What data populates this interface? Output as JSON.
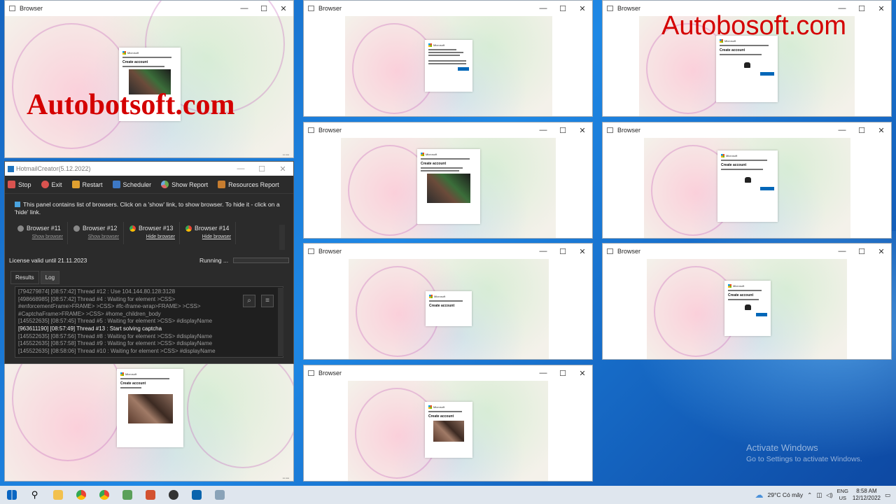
{
  "browser_windows": [
    {
      "title": "Browser"
    },
    {
      "title": "Browser"
    },
    {
      "title": "Browser"
    },
    {
      "title": "Browser"
    },
    {
      "title": "Browser"
    },
    {
      "title": "Browser"
    },
    {
      "title": "Browser"
    },
    {
      "title": "Browser"
    },
    {
      "title": "Browser"
    }
  ],
  "window_controls": {
    "minimize": "—",
    "maximize": "☐",
    "close": "✕"
  },
  "watermarks": {
    "left": "Autobotsoft.com",
    "right": "Autobosoft.com"
  },
  "card_text": {
    "brand": "Microsoft",
    "create_account": "Create account"
  },
  "hotmail": {
    "title": "HotmailCreator(5.12.2022)",
    "toolbar": [
      {
        "label": "Stop",
        "icon": "stop-icon",
        "color": "#d9534f"
      },
      {
        "label": "Exit",
        "icon": "power-icon",
        "color": "#d9534f"
      },
      {
        "label": "Restart",
        "icon": "restart-icon",
        "color": "#e0a030"
      },
      {
        "label": "Scheduler",
        "icon": "calendar-icon",
        "color": "#3d78c4"
      },
      {
        "label": "Show Report",
        "icon": "pie-chart-icon",
        "color": "#6aa84f"
      },
      {
        "label": "Resources Report",
        "icon": "resources-icon",
        "color": "#c77d2f"
      }
    ],
    "info_text": "This panel contains list of browsers. Click on a 'show' link, to show browser. To hide it - click on a 'hide' link.",
    "browsers": [
      {
        "name": "Browser #11",
        "link": "Show browser",
        "visible": false
      },
      {
        "name": "Browser #12",
        "link": "Show browser",
        "visible": false
      },
      {
        "name": "Browser #13",
        "link": "Hide browser",
        "visible": true
      },
      {
        "name": "Browser #14",
        "link": "Hide browser",
        "visible": true
      }
    ],
    "license": "License valid until 21.11.2023",
    "status": "Running ...",
    "tabs": [
      "Results",
      "Log"
    ],
    "log_lines": [
      "[794279874] [08:57:42] Thread #12 : Use 104.144.80.128:3128",
      "[498668985] [08:57:42] Thread #4 : Waiting for element >CSS>",
      "#enforcementFrame>FRAME> >CSS> #fc-iframe-wrap>FRAME> >CSS>",
      "#CaptchaFrame>FRAME> >CSS> #home_children_body",
      "[145522635] [08:57:45] Thread #5 : Waiting for element >CSS> #displayName",
      "[963611190] [08:57:49] Thread #13 : Start solving captcha",
      "[145522635] [08:57:56] Thread #8 : Waiting for element >CSS> #displayName",
      "[145522635] [08:57:58] Thread #9 : Waiting for element >CSS> #displayName",
      "[145522635] [08:58:06] Thread #10 : Waiting for element >CSS> #displayName"
    ],
    "log_highlight_index": 5
  },
  "activate_windows": {
    "title": "Activate Windows",
    "subtitle": "Go to Settings to activate Windows."
  },
  "taskbar": {
    "weather": "29°C  Có mây",
    "lang_top": "ENG",
    "lang_bottom": "US",
    "time": "8:58 AM",
    "date": "12/12/2022"
  }
}
